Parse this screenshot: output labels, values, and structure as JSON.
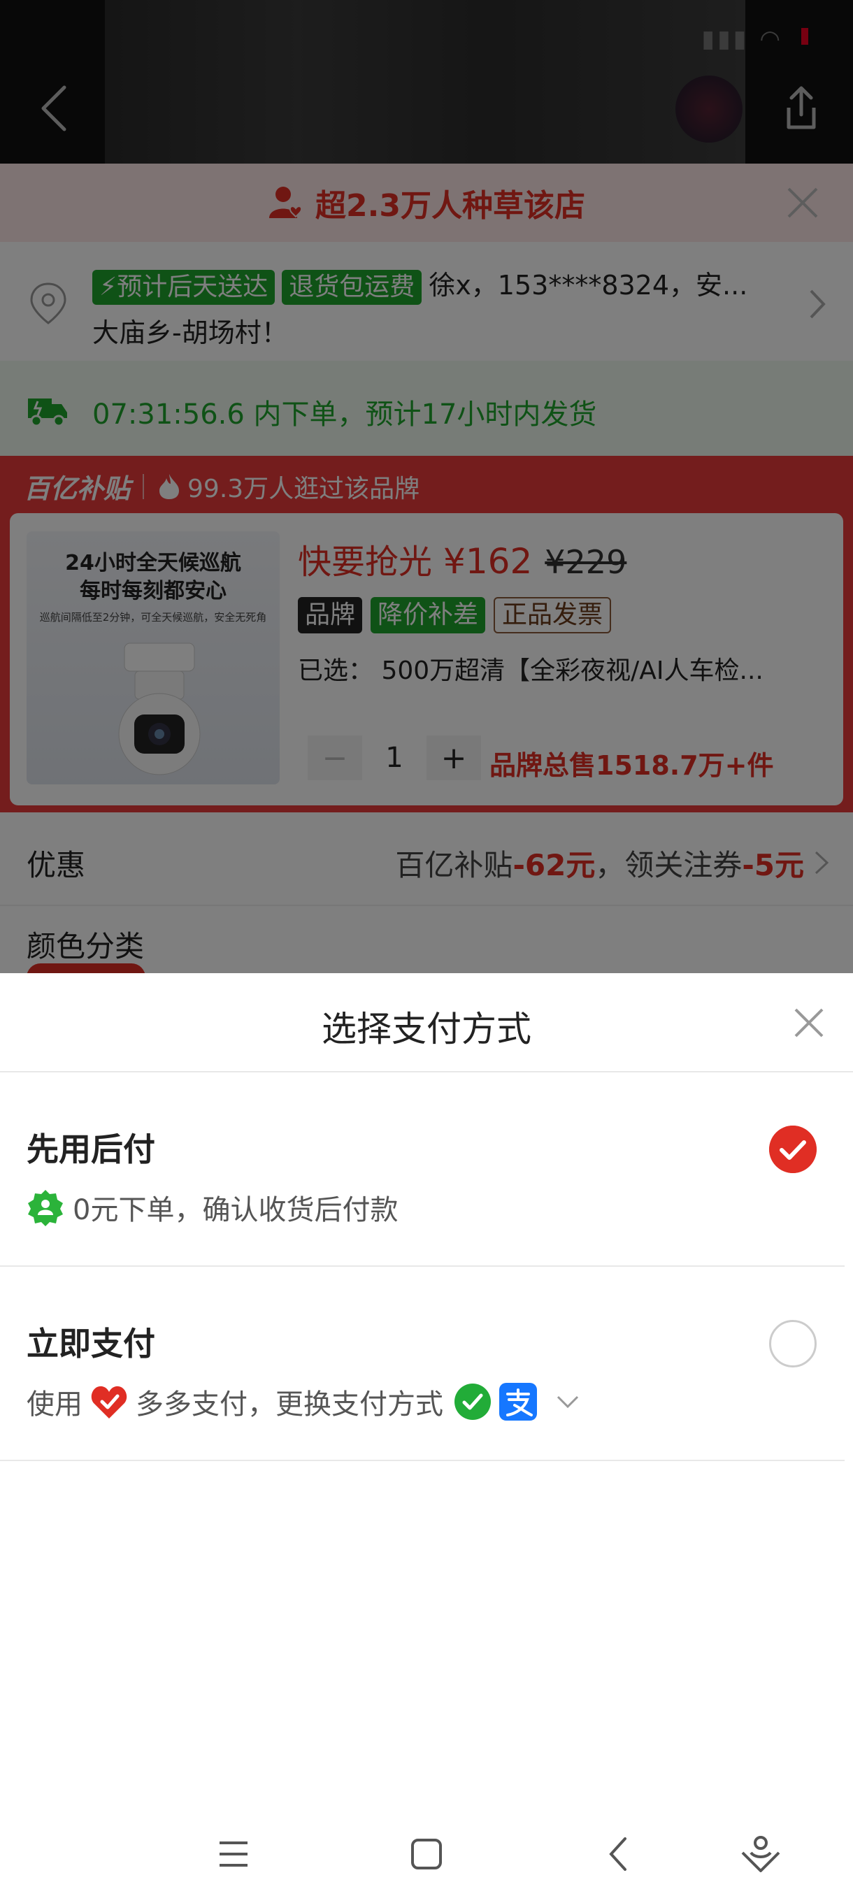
{
  "banner": {
    "fans_text": "超2.3万人种草该店"
  },
  "address": {
    "tag_delivery": "预计后天送达",
    "tag_return": "退货包运费",
    "line1": "徐x，153****8324，安...",
    "line2": "大庙乡-胡场村！"
  },
  "shipping": {
    "text": "07:31:56.6  内下单，预计17小时内发货"
  },
  "subsidy": {
    "logo": "百亿补贴",
    "visits": "99.3万人逛过该品牌"
  },
  "product": {
    "image_title": "24小时全天候巡航\n每时每刻都安心",
    "image_sub": "巡航间隔低至2分钟，可全天候巡航，安全无死角",
    "hurry": "快要抢光",
    "price": "¥162",
    "old_price": "¥229",
    "badges": [
      "品牌",
      "降价补差",
      "正品发票"
    ],
    "selected": "已选：  500万超清【全彩夜视/AI人车检...",
    "qty_minus": "−",
    "qty": "1",
    "qty_plus": "+",
    "brand_sales": "品牌总售1518.7万+件"
  },
  "discount": {
    "label": "优惠",
    "value_prefix": "百亿补贴",
    "value_amount1": "-62元",
    "value_mid": "，领关注券",
    "value_amount2": "-5元"
  },
  "color": {
    "label": "颜色分类"
  },
  "sheet": {
    "title": "选择支付方式",
    "options": [
      {
        "title": "先用后付",
        "desc": "0元下单，确认收货后付款",
        "selected": true
      },
      {
        "title": "立即支付",
        "desc_prefix": "使用",
        "desc_main": "多多支付，更换支付方式",
        "selected": false
      }
    ]
  },
  "colors": {
    "accent": "#e02e24",
    "green": "#1fa52c"
  },
  "icons": [
    "back-icon",
    "share-icon",
    "close-icon",
    "location-pin-icon",
    "truck-icon",
    "flame-icon",
    "check-icon",
    "wechat-pay-icon",
    "alipay-icon",
    "chevron-down-icon",
    "menu-icon",
    "home-icon",
    "nav-back-icon",
    "assistant-icon"
  ]
}
